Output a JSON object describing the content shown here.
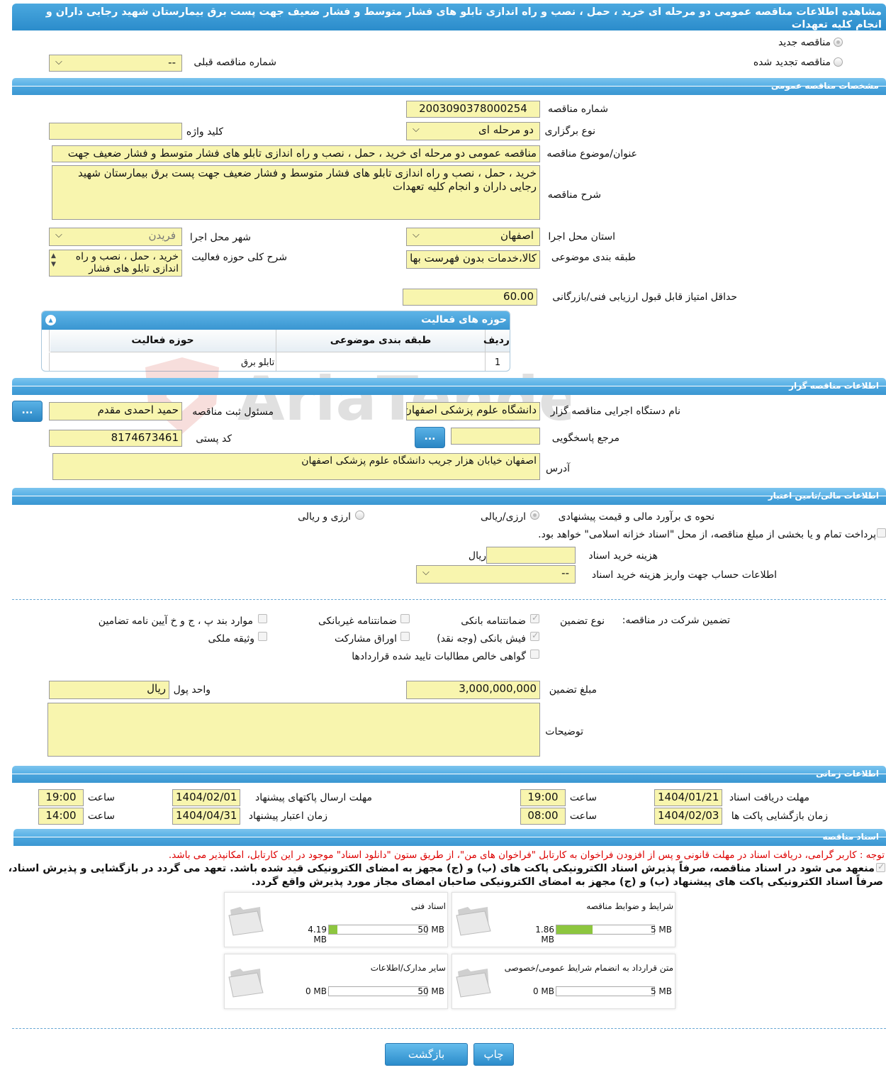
{
  "header": {
    "title": "مشاهده اطلاعات مناقصه عمومی دو مرحله ای خرید ، حمل ، نصب و راه اندازی تابلو های فشار متوسط و فشار ضعیف جهت پست برق بیمارستان شهید رجایی داران و انجام کلیه تعهدات"
  },
  "tender_type": {
    "new_label": "مناقصه جدید",
    "renewed_label": "مناقصه تجدید شده",
    "previous_number_label": "شماره مناقصه قبلی",
    "previous_number_value": "--"
  },
  "general": {
    "section_title": "مشخصات مناقصه عمومی",
    "number_label": "شماره مناقصه",
    "number_value": "2003090378000254",
    "holding_type_label": "نوع برگزاری",
    "holding_type_value": "دو مرحله ای",
    "keyword_label": "کلید واژه",
    "keyword_value": "",
    "subject_label": "عنوان/موضوع مناقصه",
    "subject_value": "مناقصه عمومی دو مرحله ای خرید ، حمل ، نصب و راه اندازی تابلو های فشار متوسط و فشار ضعیف جهت",
    "description_label": "شرح مناقصه",
    "description_value": "خرید ، حمل ، نصب و راه اندازی تابلو های فشار متوسط و فشار ضعیف جهت پست برق بیمارستان شهید رجایی داران و انجام کلیه تعهدات",
    "province_label": "استان محل اجرا",
    "province_value": "اصفهان",
    "city_label": "شهر محل اجرا",
    "city_value": "فریدن",
    "category_label": "طبقه بندی موضوعی",
    "category_value": "کالا،خدمات بدون فهرست بها",
    "activity_desc_label": "شرح کلی حوزه فعالیت",
    "activity_desc_value": "خرید ، حمل ، نصب و راه اندازی تابلو های فشار",
    "min_score_label": "حداقل امتیاز قابل قبول ارزیابی فنی/بازرگانی",
    "min_score_value": "60.00"
  },
  "activities": {
    "title": "حوزه های فعالیت",
    "columns": [
      "ردیف",
      "طبقه بندی موضوعی",
      "حوزه فعالیت"
    ],
    "rows": [
      {
        "row": "1",
        "category": "",
        "activity": "تابلو برق"
      }
    ]
  },
  "organizer": {
    "section_title": "اطلاعات مناقصه گزار",
    "org_label": "نام دستگاه اجرایی مناقصه گزار",
    "org_value": "دانشگاه علوم پزشکی اصفهان",
    "responsible_label": "مسئول ثبت مناقصه",
    "responsible_value": "حمید احمدی مقدم",
    "reference_label": "مرجع پاسخگویی",
    "reference_value": "",
    "postal_label": "کد پستی",
    "postal_value": "8174673461",
    "address_label": "آدرس",
    "address_value": "اصفهان خیابان هزار جریب دانشگاه علوم پزشکی اصفهان",
    "dots_label": "..."
  },
  "finance": {
    "section_title": "اطلاعات مالی/تامین اعتبار",
    "estimate_label": "نحوه ی برآورد مالی و قیمت پیشنهادی",
    "opt_currency_rial": "ارزی/ریالی",
    "opt_currency_and_rial": "ارزی و ریالی",
    "treasury_note": "پرداخت تمام و یا بخشی از مبلغ مناقصه، از محل \"اسناد خزانه اسلامی\" خواهد بود.",
    "doc_cost_label": "هزینه خرید اسناد",
    "doc_cost_value": "",
    "doc_cost_unit": "ریال",
    "account_label": "اطلاعات حساب جهت واریز هزینه خرید اسناد",
    "account_value": "--"
  },
  "guarantee": {
    "section_label": "تضمین شرکت در مناقصه:",
    "type_label": "نوع تضمین",
    "options": {
      "bank_guarantee": "ضمانتنامه بانکی",
      "non_bank_guarantee": "ضمانتنامه غیربانکی",
      "clauses": "موارد بند پ ، ج و خ آیین نامه تضامین",
      "bank_receipt": "فیش بانکی (وجه نقد)",
      "bonds": "اوراق مشارکت",
      "property": "وثیقه ملکی",
      "receivables": "گواهی خالص مطالبات تایید شده قراردادها"
    },
    "amount_label": "مبلغ تضمین",
    "amount_value": "3,000,000,000",
    "currency_label": "واحد پول",
    "currency_value": "ریال",
    "notes_label": "توضیحات",
    "notes_value": ""
  },
  "timing": {
    "section_title": "اطلاعات زمانی",
    "doc_deadline_label": "مهلت دریافت اسناد",
    "doc_deadline_date": "1404/01/21",
    "doc_deadline_time": "19:00",
    "submit_deadline_label": "مهلت ارسال پاکتهای پیشنهاد",
    "submit_deadline_date": "1404/02/01",
    "submit_deadline_time": "19:00",
    "opening_label": "زمان بازگشایی پاکت ها",
    "opening_date": "1404/02/03",
    "opening_time": "08:00",
    "validity_label": "زمان اعتبار پیشنهاد",
    "validity_date": "1404/04/31",
    "validity_time": "14:00",
    "time_label": "ساعت"
  },
  "documents": {
    "section_title": "اسناد مناقصه",
    "notice": "توجه : کاربر گرامی، دریافت اسناد در مهلت قانونی و پس از افزودن فراخوان به کارتابل \"فراخوان های من\"، از طریق ستون \"دانلود اسناد\" موجود در این کارتابل، امکانپذیر می باشد.",
    "commitment_line1": "منعهد می شود در اسناد مناقصه، صرفاً پذیرش اسناد الکترونیکی پاکت های (ب) و (ج) مجهز به امضای الکترونیکی قید شده باشد. تعهد می گردد در بازگشایی و پذیرش اسناد،",
    "commitment_line2": "صرفاً اسناد الکترونیکی پاکت های پیشنهاد (ب) و (ج) مجهز به امضای الکترونیکی صاحبان امضای مجاز مورد پذیرش واقع گردد.",
    "cards": [
      {
        "title": "شرایط و ضوابط مناقصه",
        "size": "1.86 MB",
        "max": "5 MB",
        "fill": 0.372
      },
      {
        "title": "اسناد فنی",
        "size": "4.19 MB",
        "max": "50 MB",
        "fill": 0.084
      },
      {
        "title": "متن قرارداد به انضمام شرایط عمومی/خصوصی",
        "size": "0 MB",
        "max": "5 MB",
        "fill": 0
      },
      {
        "title": "سایر مدارک/اطلاعات",
        "size": "0 MB",
        "max": "50 MB",
        "fill": 0
      }
    ]
  },
  "actions": {
    "print_label": "چاپ",
    "back_label": "بازگشت"
  },
  "watermark_text": "AriaTender.neT"
}
